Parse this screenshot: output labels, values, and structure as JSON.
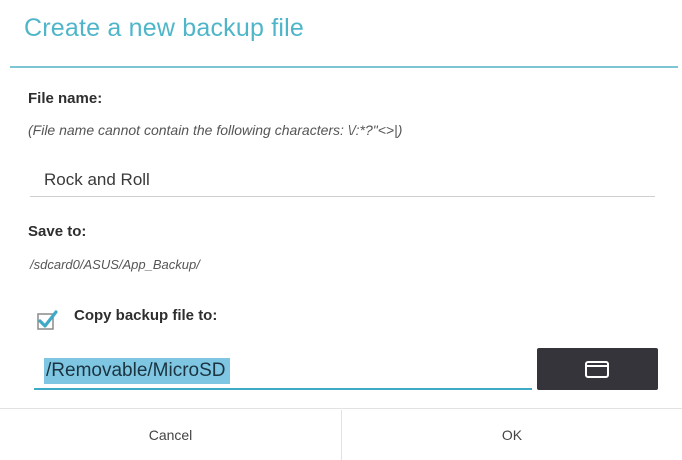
{
  "dialog": {
    "title": "Create a new backup file",
    "accent_color": "#4fb6c9",
    "file_name": {
      "label": "File name:",
      "hint": "(File name cannot contain the following characters: \\/:*?\"<>|)",
      "value": "Rock and Roll"
    },
    "save_to": {
      "label": "Save to:",
      "path": "/sdcard0/ASUS/App_Backup/"
    },
    "copy": {
      "checked": true,
      "label": "Copy backup file to:",
      "destination": "/Removable/MicroSD",
      "browse_icon": "folder-icon"
    },
    "buttons": {
      "cancel": "Cancel",
      "ok": "OK"
    }
  }
}
